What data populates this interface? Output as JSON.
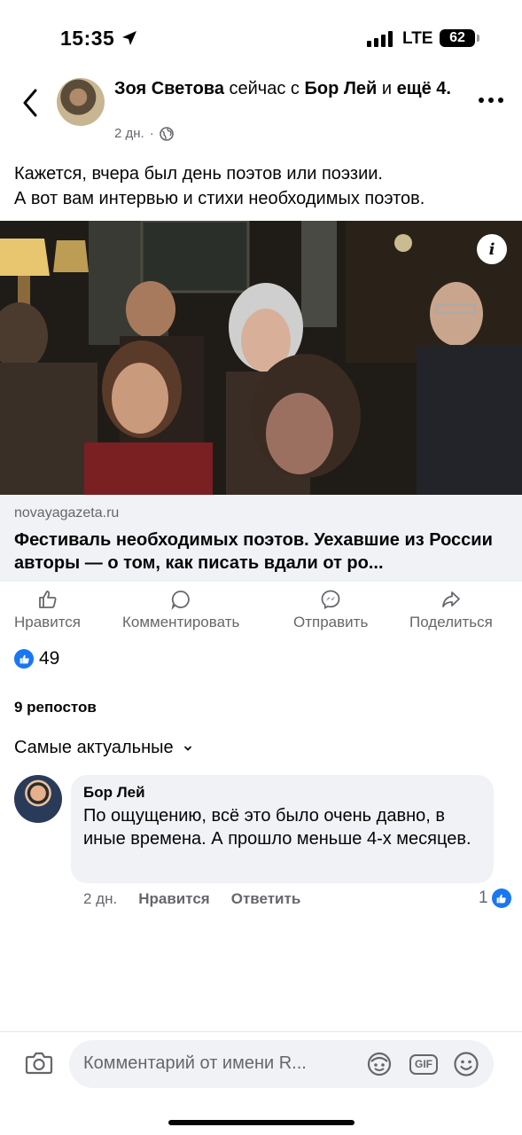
{
  "status": {
    "time": "15:35",
    "network": "LTE",
    "battery": "62"
  },
  "post": {
    "author": "Зоя Светова",
    "with_text": "сейчас с",
    "tagged": "Бор Лей",
    "and_text": "и",
    "others": "ещё 4.",
    "time": "2 дн.",
    "separator": "·",
    "text_lines": [
      "Кажется, вчера был день поэтов или поэзии.",
      "А вот вам интервью и стихи необходимых поэтов."
    ],
    "link": {
      "domain": "novayagazeta.ru",
      "title": "Фестиваль необходимых поэтов. Уехавшие из России авторы — о том, как писать вдали от ро..."
    }
  },
  "actions": [
    "Нравится",
    "Комментировать",
    "Отправить",
    "Поделиться"
  ],
  "reactions": {
    "count": "49"
  },
  "reposts": "9 репостов",
  "sort_label": "Самые актуальные",
  "comment": {
    "author": "Бор Лей",
    "text": "По ощущению, всё это было очень давно, в иные времена. А прошло меньше 4-х месяцев.",
    "time": "2 дн.",
    "like_label": "Нравится",
    "reply_label": "Ответить",
    "likes": "1"
  },
  "composer": {
    "placeholder": "Комментарий от имени R..."
  },
  "colors": {
    "accent": "#1877f2",
    "muted": "#65676b"
  }
}
